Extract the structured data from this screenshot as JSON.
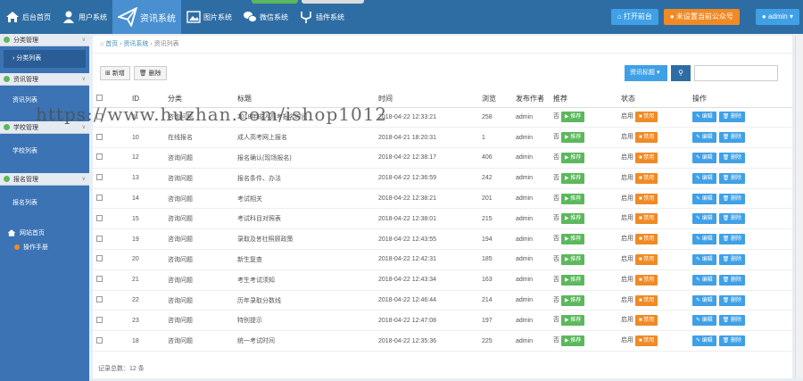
{
  "nav": [
    {
      "label": "后台首页",
      "icon": "home-icon"
    },
    {
      "label": "用户系统",
      "icon": "user-icon"
    },
    {
      "label": "资讯系统",
      "icon": "send-icon",
      "active": true
    },
    {
      "label": "图片系统",
      "icon": "image-icon"
    },
    {
      "label": "微信系统",
      "icon": "wechat-icon"
    },
    {
      "label": "插件系统",
      "icon": "plugin-icon"
    }
  ],
  "top": {
    "open": "打开前台",
    "wechat": "未设置当前公众号",
    "admin": "admin"
  },
  "sidebar": {
    "groups": [
      {
        "title": "分类管理",
        "items": [
          "分类列表"
        ]
      },
      {
        "title": "资讯管理",
        "items": [
          "资讯列表"
        ]
      },
      {
        "title": "学校管理",
        "items": [
          "学校列表"
        ]
      },
      {
        "title": "报名管理",
        "items": [
          "报名列表"
        ]
      }
    ],
    "home": "网站首页",
    "manual": "操作手册"
  },
  "breadcrumb": {
    "home": "首页",
    "system": "资讯系统",
    "current": "资讯列表"
  },
  "toolbar": {
    "add": "新增",
    "delete": "删除"
  },
  "search": {
    "select": "资讯标题"
  },
  "columns": [
    "ID",
    "分类",
    "标题",
    "时间",
    "浏览",
    "发布作者",
    "推荐",
    "状态",
    "操作"
  ],
  "rows": [
    {
      "id": "11",
      "cat": "咨询问题",
      "title": "2018年成人高考报名时间",
      "time": "2018-04-22 12:33:21",
      "views": "258",
      "author": "admin"
    },
    {
      "id": "10",
      "cat": "在线报名",
      "title": "成人高考网上报名",
      "time": "2018-04-21 18:20:31",
      "views": "1",
      "author": "admin"
    },
    {
      "id": "12",
      "cat": "咨询问题",
      "title": "报名确认(现场报名)",
      "time": "2018-04-22 12:38:17",
      "views": "406",
      "author": "admin"
    },
    {
      "id": "13",
      "cat": "咨询问题",
      "title": "报名条件、办法",
      "time": "2018-04-22 12:36:59",
      "views": "242",
      "author": "admin"
    },
    {
      "id": "14",
      "cat": "咨询问题",
      "title": "考试相关",
      "time": "2018-04-22 12:38:21",
      "views": "201",
      "author": "admin"
    },
    {
      "id": "15",
      "cat": "咨询问题",
      "title": "考试科目对照表",
      "time": "2018-04-22 12:38:01",
      "views": "215",
      "author": "admin"
    },
    {
      "id": "19",
      "cat": "咨询问题",
      "title": "录取及봉社照顾政策",
      "time": "2018-04-22 12:43:55",
      "views": "194",
      "author": "admin"
    },
    {
      "id": "20",
      "cat": "咨询问题",
      "title": "新生复查",
      "time": "2018-04-22 12:42:31",
      "views": "185",
      "author": "admin"
    },
    {
      "id": "21",
      "cat": "咨询问题",
      "title": "考生考试须知",
      "time": "2018-04-22 12:43:34",
      "views": "163",
      "author": "admin"
    },
    {
      "id": "22",
      "cat": "咨询问题",
      "title": "历年录取分数线",
      "time": "2018-04-22 12:46:44",
      "views": "214",
      "author": "admin"
    },
    {
      "id": "23",
      "cat": "咨询问题",
      "title": "特别提示",
      "time": "2018-04-22 12:47:08",
      "views": "197",
      "author": "admin"
    },
    {
      "id": "18",
      "cat": "咨询问题",
      "title": "统一考试时间",
      "time": "2018-04-22 12:35:36",
      "views": "225",
      "author": "admin"
    }
  ],
  "row_labels": {
    "recommend_no": "否",
    "recommend_btn": "推荐",
    "status_on": "启用",
    "disable_btn": "禁用",
    "edit_btn": "编辑",
    "delete_btn": "删除"
  },
  "footer": "记录总数：12 条",
  "watermark": "https://www.huzhan.com/ishop1012"
}
